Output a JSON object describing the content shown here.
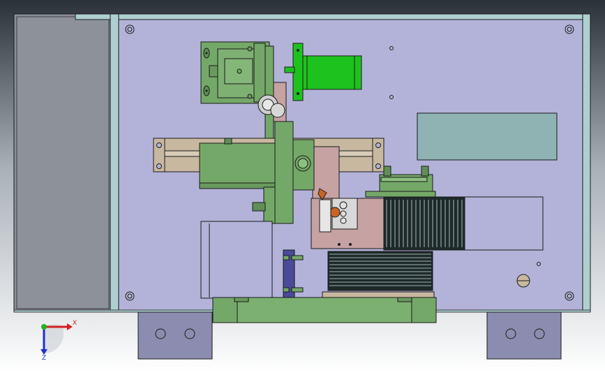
{
  "viewport": {
    "background_top": "#2b3138",
    "background_mid": "#a9b0b8",
    "background_bottom": "#ffffff"
  },
  "colors": {
    "plate": "#b3b3d9",
    "frame": "#aecfd0",
    "side_panel": "#8a8f98",
    "green_part": "#74a868",
    "bright_green": "#1ec21e",
    "pink_part": "#c6a2a2",
    "tan_part": "#c8b8a0",
    "display_window": "#8fb3b3",
    "feet": "#8c8cb0",
    "navy_part": "#4a4a9a",
    "bellows_dark": "#1e2a2a",
    "bellows_light": "#cfe0e0",
    "outline": "#1a1a1a"
  },
  "axis_triad": {
    "x_label": "X",
    "z_label": "Z",
    "x_color": "#d62020",
    "y_color": "#22b322",
    "z_color": "#2030c8"
  },
  "icons": {
    "triad": "coordinate-axis-triad-icon"
  }
}
